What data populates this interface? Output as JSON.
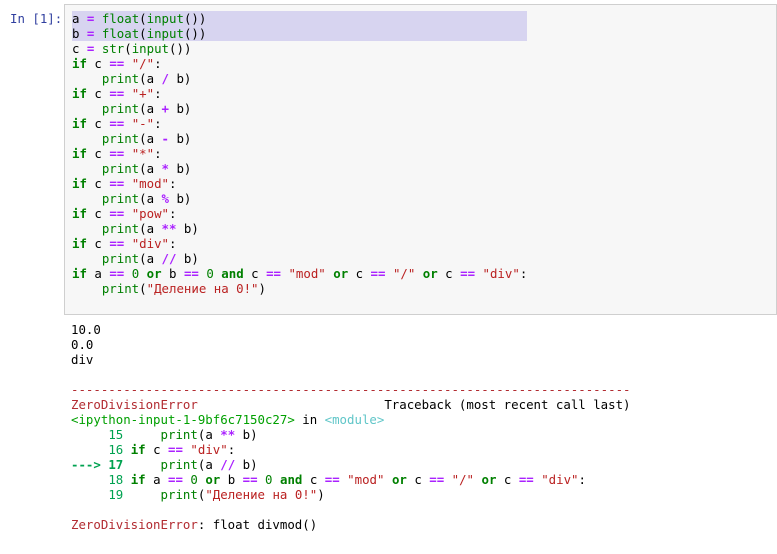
{
  "prompt": "In [1]:",
  "code_lines": [
    "a = float(input())",
    "b = float(input())",
    "c = str(input())",
    "if c == \"/\":",
    "    print(a / b)",
    "if c == \"+\":",
    "    print(a + b)",
    "if c == \"-\":",
    "    print(a - b)",
    "if c == \"*\":",
    "    print(a * b)",
    "if c == \"mod\":",
    "    print(a % b)",
    "if c == \"pow\":",
    "    print(a ** b)",
    "if c == \"div\":",
    "    print(a // b)",
    "if a == 0 or b == 0 and c == \"mod\" or c == \"/\" or c == \"div\":",
    "    print(\"Деление на 0!\")"
  ],
  "output": {
    "stdout": [
      "10.0",
      "0.0",
      "div"
    ],
    "separator": "---------------------------------------------------------------------------",
    "error_name": "ZeroDivisionError",
    "traceback_header": "Traceback (most recent call last)",
    "input_ref": "<ipython-input-1-9bf6c7150c27>",
    "in_word": " in ",
    "module_ref": "<module>",
    "tb_lines": [
      {
        "marker": "     ",
        "num": "15",
        "code": "     print(a ** b)"
      },
      {
        "marker": "     ",
        "num": "16",
        "code": " if c == \"div\":"
      },
      {
        "marker": "---> ",
        "num": "17",
        "code": "     print(a // b)"
      },
      {
        "marker": "     ",
        "num": "18",
        "code": " if a == 0 or b == 0 and c == \"mod\" or c == \"/\" or c == \"div\":"
      },
      {
        "marker": "     ",
        "num": "19",
        "code": "     print(\"Деление на 0!\")"
      }
    ],
    "final_error": "ZeroDivisionError",
    "final_message": ": float divmod()"
  }
}
